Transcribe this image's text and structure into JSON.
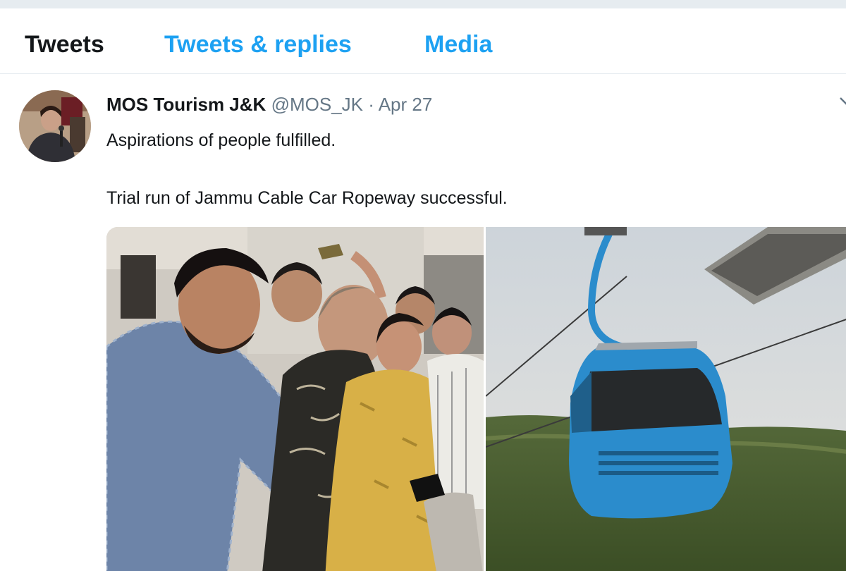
{
  "tabs": [
    {
      "label": "Tweets",
      "active": true
    },
    {
      "label": "Tweets & replies",
      "active": false
    },
    {
      "label": "Media",
      "active": false
    }
  ],
  "tweet": {
    "author_name": "MOS Tourism J&K",
    "handle": "@MOS_JK",
    "separator": "·",
    "date": "Apr 27",
    "text_line1": "Aspirations of people fulfilled.",
    "text_line2": "Trial run of Jammu Cable Car Ropeway successful.",
    "menu_icon": "chevron-down-icon",
    "media": [
      "ribbon-cutting-photo",
      "cable-car-gondola-photo"
    ]
  },
  "colors": {
    "accent": "#1da1f2",
    "text": "#14171a",
    "muted": "#657786",
    "page_bg": "#e6ecf0",
    "gondola": "#2b8ccc"
  }
}
